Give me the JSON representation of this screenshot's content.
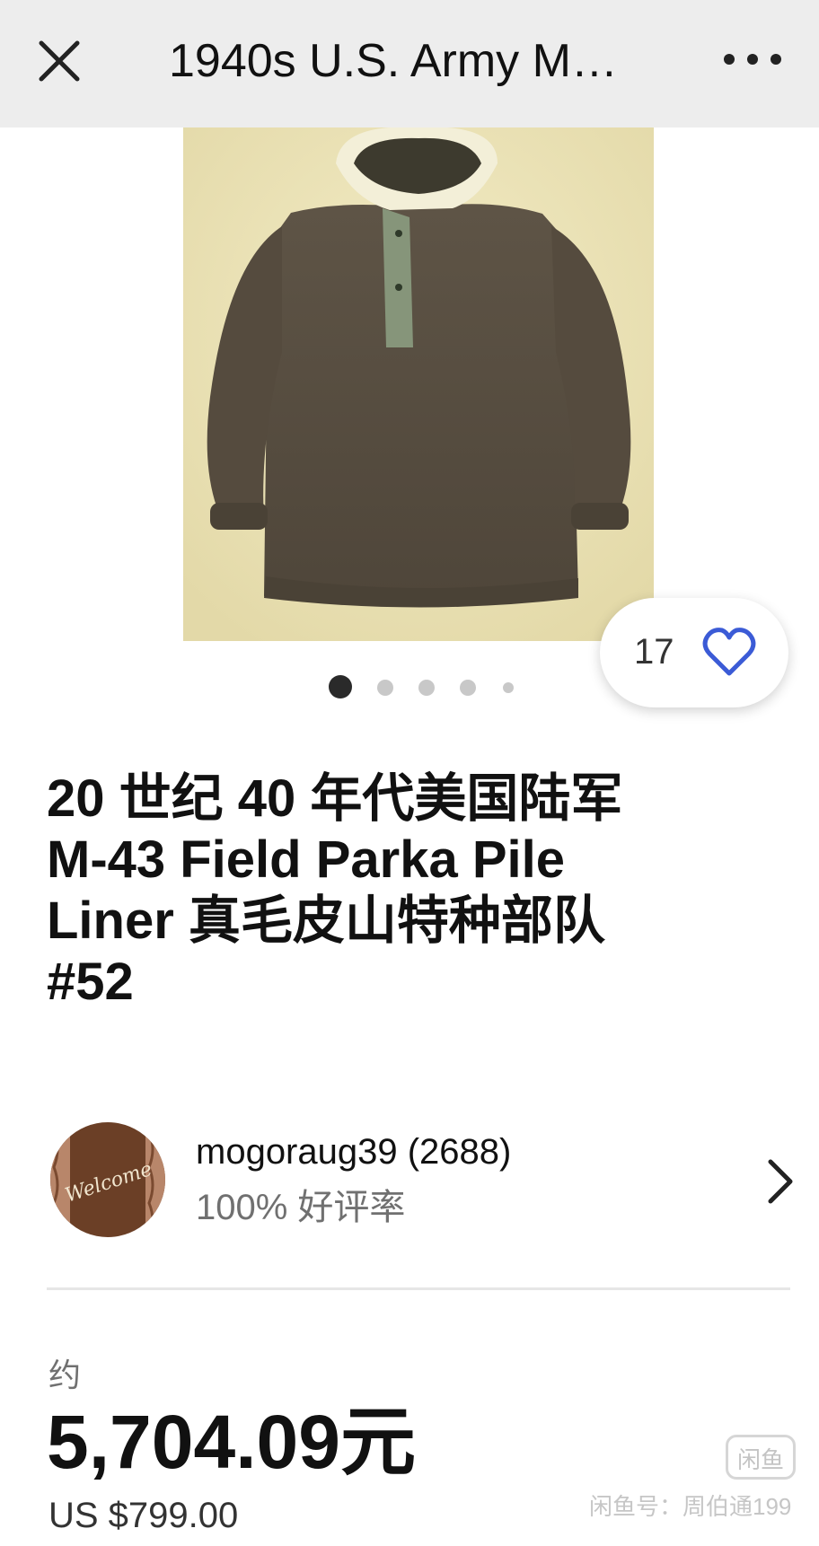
{
  "header": {
    "title": "1940s U.S. Army M…",
    "close_icon": "close-icon",
    "more_icon": "more-horizontal-icon"
  },
  "gallery": {
    "image_count": 5,
    "active_index": 0,
    "like_count": "17",
    "like_icon": "heart-outline-icon",
    "like_color": "#3b5bd6"
  },
  "item": {
    "title_lines": [
      "20 世纪 40 年代美国陆军",
      "M-43 Field Parka Pile",
      "Liner 真毛皮山特种部队",
      "#52"
    ]
  },
  "seller": {
    "name": "mogoraug39 (2688)",
    "rating": "100% 好评率",
    "avatar_text": "Welcome",
    "chevron_icon": "chevron-right-icon"
  },
  "price": {
    "approx_label": "约",
    "cny": "5,704.09元",
    "usd": "US $799.00"
  },
  "watermark": {
    "badge": "闲鱼",
    "text": "闲鱼号：周伯通199"
  },
  "colors": {
    "topbar_bg": "#ededed",
    "accent_blue": "#3b5bd6",
    "text_primary": "#111111",
    "text_secondary": "#707070"
  }
}
